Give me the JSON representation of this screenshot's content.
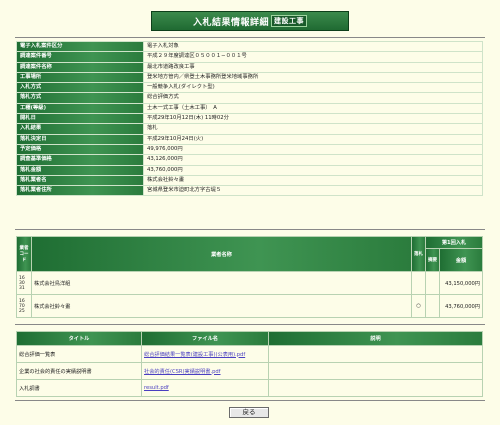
{
  "header": {
    "title": "入札結果情報詳細",
    "tag": "建設工事"
  },
  "info_rows": [
    {
      "label": "電子入札案件区分",
      "value": "電子入札対象"
    },
    {
      "label": "調達案件番号",
      "value": "平成２９年度調達区０５００１−００１号"
    },
    {
      "label": "調達案件名称",
      "value": "最北市道路改良工事"
    },
    {
      "label": "工事場所",
      "value": "登米地方管内／県登土木事務所登米地域事務所"
    },
    {
      "label": "入札方式",
      "value": "一般競争入札(ダイレクト型)"
    },
    {
      "label": "落札方式",
      "value": "総合評価方式"
    },
    {
      "label": "工種(等級)",
      "value": "土木一式工事（土木工事）　A"
    },
    {
      "label": "開札日",
      "value": "平成29年10月12日(木) 11時02分"
    },
    {
      "label": "入札結果",
      "value": "落札"
    },
    {
      "label": "落札決定日",
      "value": "平成29年10月24日(火)"
    },
    {
      "label": "予定価格",
      "value": "49,976,000円"
    },
    {
      "label": "調査基準価格",
      "value": "43,126,000円"
    },
    {
      "label": "落札金額",
      "value": "43,760,000円"
    },
    {
      "label": "落札業者名",
      "value": "株式会社鈴々畫"
    },
    {
      "label": "落札業者住所",
      "value": "宮城県登米市迫町北方字古堤５"
    }
  ],
  "bids": {
    "headers": {
      "no": "業者コード",
      "name": "業者名称",
      "mark": "落札",
      "round": "第1回入札",
      "sub1": "摘要",
      "sub2": "金額"
    },
    "rows": [
      {
        "no": "16 30 31",
        "name": "株式会社鳥洋組",
        "mark": "",
        "amount": "43,150,000円"
      },
      {
        "no": "16 70 25",
        "name": "株式会社鈴々畫",
        "mark": "○",
        "amount": "43,760,000円"
      }
    ]
  },
  "files": {
    "headers": {
      "title": "タイトル",
      "file": "ファイル名",
      "desc": "説明"
    },
    "rows": [
      {
        "title": "総合評価一覧表",
        "file": "総合評価結果一覧表(建設工事)(公表用).pdf"
      },
      {
        "title": "企業の社会的責任の実績説明書",
        "file": "社会的責任(CSR)実績説明書.pdf"
      },
      {
        "title": "入札調書",
        "file": "result.pdf"
      }
    ]
  },
  "back_button": {
    "label": "戻る"
  }
}
